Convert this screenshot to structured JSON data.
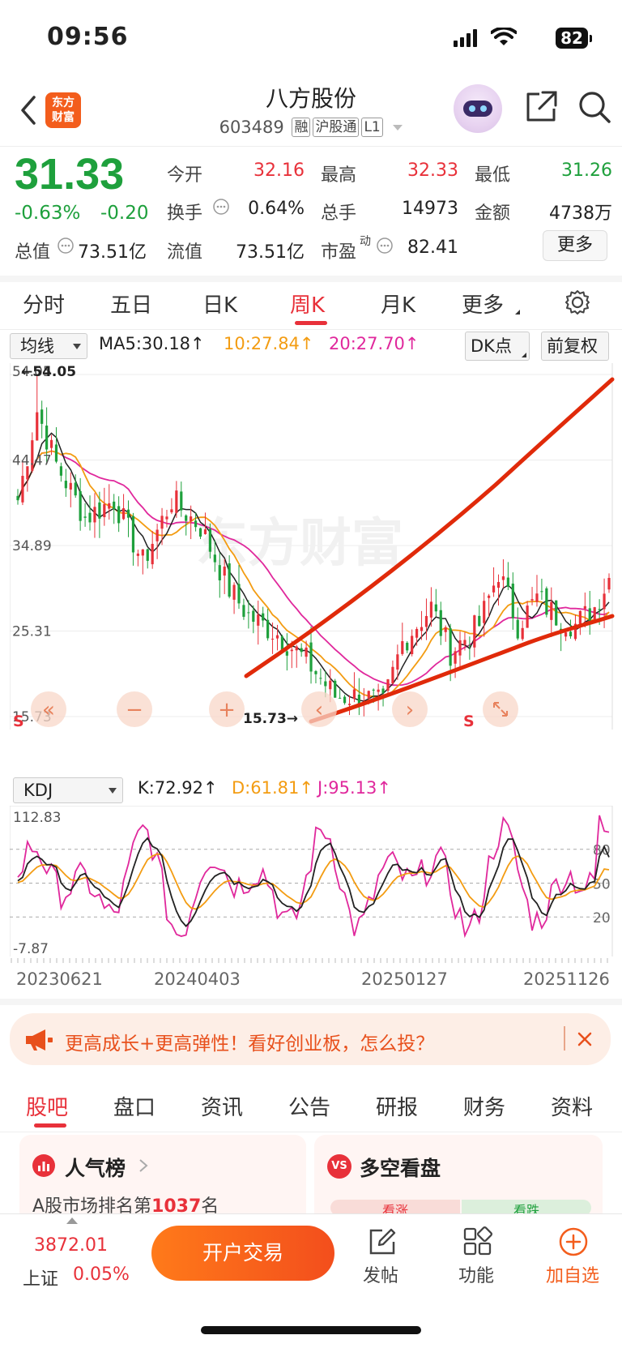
{
  "status_bar": {
    "time": "09:56",
    "battery": "82"
  },
  "header": {
    "logo_text_1": "东方",
    "logo_text_2": "财富",
    "title": "八方股份",
    "code": "603489",
    "tags": [
      "融",
      "沪股通",
      "L1"
    ]
  },
  "quote": {
    "price": "31.33",
    "change_pct": "-0.63%",
    "change": "-0.20",
    "fields": [
      {
        "label": "今开",
        "value": "32.16",
        "color": "#e8313a"
      },
      {
        "label": "最高",
        "value": "32.33",
        "color": "#e8313a"
      },
      {
        "label": "最低",
        "value": "31.26",
        "color": "#1ea03c"
      },
      {
        "label": "换手",
        "value": "0.64%",
        "color": "#222222"
      },
      {
        "label": "总手",
        "value": "14973",
        "color": "#222222"
      },
      {
        "label": "金额",
        "value": "4738万",
        "color": "#222222"
      },
      {
        "label": "总值",
        "value": "73.51亿",
        "color": "#222222"
      },
      {
        "label": "流值",
        "value": "73.51亿",
        "color": "#222222"
      },
      {
        "label": "市盈",
        "value": "82.41",
        "color": "#222222"
      }
    ],
    "pe_sup": "动",
    "more": "更多"
  },
  "ktabs": [
    "分时",
    "五日",
    "日K",
    "周K",
    "月K",
    "更多"
  ],
  "active_ktab": "周K",
  "main_chart": {
    "indicator": "均线",
    "ma5": "MA5:30.18",
    "ma10": "10:27.84",
    "ma20": "20:27.70",
    "dk_button": "DK点",
    "adjust_button": "前复权",
    "y_labels": [
      "54.05",
      "44.47",
      "34.89",
      "25.31",
      "15.73"
    ],
    "max_marker": "54.05",
    "min_marker": "15.73",
    "signal": "S",
    "watermark": "东方财富",
    "colors": {
      "ma5": "#222222",
      "ma10": "#f39c12",
      "ma20": "#e0289c",
      "up": "#e8313a",
      "down": "#1ea03c",
      "trend": "#e02a0a"
    }
  },
  "chart_data": {
    "type": "candlestick",
    "ylim": [
      15.73,
      54.05
    ],
    "x_ticks": [
      "20230621",
      "20240403",
      "20250127",
      "20251126"
    ],
    "ma5": 30.18,
    "ma10": 27.84,
    "ma20": 27.7,
    "kdj": {
      "K": 72.92,
      "D": 61.81,
      "J": 95.13,
      "ylim": [
        -7.87,
        112.83
      ],
      "levels": [
        80,
        50,
        20
      ]
    }
  },
  "kdj_panel": {
    "indicator": "KDJ",
    "k": "K:72.92",
    "d": "D:61.81",
    "j": "J:95.13",
    "y_top": "112.83",
    "y_bottom": "-7.87",
    "levels": [
      "80",
      "50",
      "20"
    ]
  },
  "x_axis": [
    "20230621",
    "20240403",
    "20250127",
    "20251126"
  ],
  "banner": {
    "text": "更高成长+更高弹性！看好创业板，怎么投？"
  },
  "bottom_tabs": [
    "股吧",
    "盘口",
    "资讯",
    "公告",
    "研报",
    "财务",
    "资料"
  ],
  "active_bottom_tab": "股吧",
  "cards": {
    "popular": {
      "title": "人气榜",
      "rank_prefix": "A股市场排名第",
      "rank": "1037",
      "rank_suffix": "名"
    },
    "longshort": {
      "title": "多空看盘",
      "bull": "看涨",
      "bear": "看跌"
    }
  },
  "bottom_bar": {
    "index_value": "3872.01",
    "index_name": "上证",
    "index_change": "0.05%",
    "open_account": "开户交易",
    "post": "发帖",
    "features": "功能",
    "add_watch": "加自选"
  }
}
